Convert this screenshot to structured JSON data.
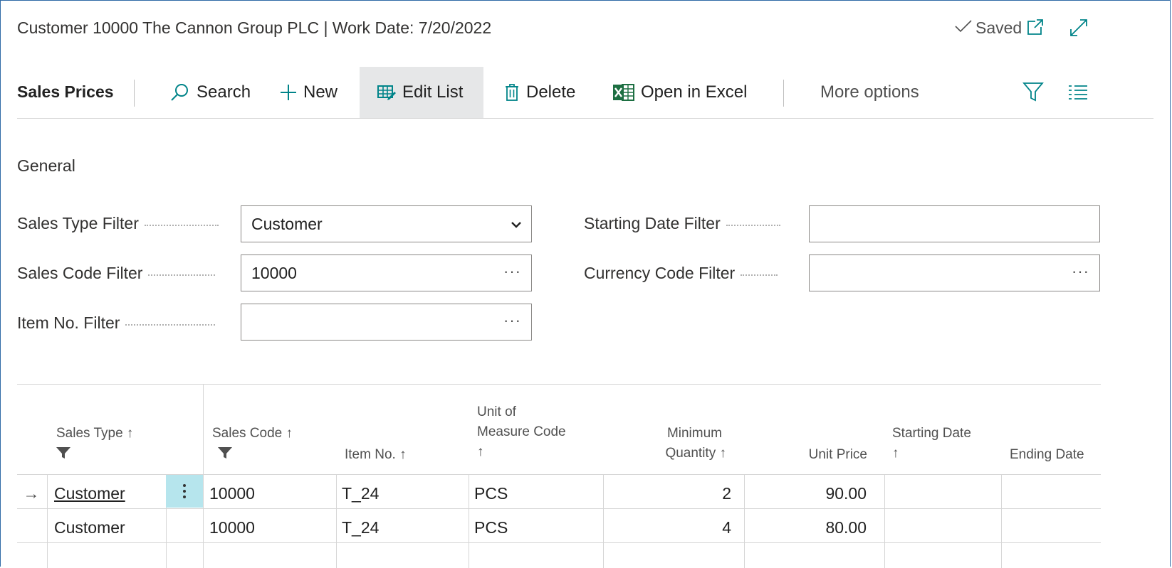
{
  "title": "Customer 10000 The Cannon Group PLC | Work Date: 7/20/2022",
  "status": "Saved",
  "toolbar": {
    "page_name": "Sales Prices",
    "search": "Search",
    "new": "New",
    "edit_list": "Edit List",
    "delete": "Delete",
    "open_excel": "Open in Excel",
    "more": "More options"
  },
  "general": {
    "title": "General",
    "sales_type_filter": {
      "label": "Sales Type Filter",
      "value": "Customer"
    },
    "sales_code_filter": {
      "label": "Sales Code Filter",
      "value": "10000"
    },
    "item_no_filter": {
      "label": "Item No. Filter",
      "value": ""
    },
    "starting_date_filter": {
      "label": "Starting Date Filter",
      "value": ""
    },
    "currency_code_filter": {
      "label": "Currency Code Filter",
      "value": ""
    }
  },
  "columns": {
    "sales_type": "Sales Type ↑",
    "sales_code": "Sales Code ↑",
    "item_no": "Item No. ↑",
    "uom_1": "Unit of",
    "uom_2": "Measure Code",
    "uom_3": "↑",
    "minqty_1": "Minimum",
    "minqty_2": "Quantity ↑",
    "unit_price": "Unit Price",
    "start_1": "Starting Date",
    "start_2": "↑",
    "ending_date": "Ending Date"
  },
  "rows": [
    {
      "arrow": "→",
      "sales_type": "Customer",
      "sales_code": "10000",
      "item_no": "T_24",
      "uom": "PCS",
      "min_qty": "2",
      "unit_price": "90.00",
      "starting_date": "",
      "ending_date": ""
    },
    {
      "arrow": "",
      "sales_type": "Customer",
      "sales_code": "10000",
      "item_no": "T_24",
      "uom": "PCS",
      "min_qty": "4",
      "unit_price": "80.00",
      "starting_date": "",
      "ending_date": ""
    }
  ],
  "colors": {
    "accent": "#008489",
    "border": "#2f6aa6",
    "selected_cell": "#b6e5ed",
    "excel": "#1d6f42"
  }
}
